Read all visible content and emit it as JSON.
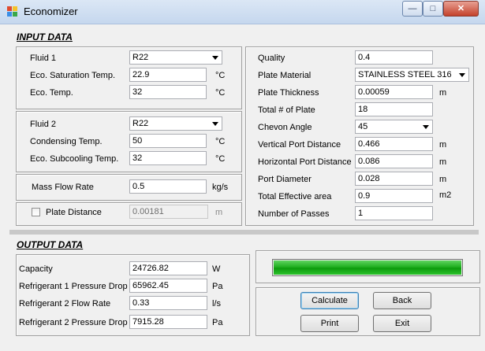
{
  "window": {
    "title": "Economizer",
    "min_glyph": "—",
    "max_glyph": "□",
    "close_glyph": "✕"
  },
  "input": {
    "title": "INPUT DATA",
    "fluid1": {
      "fluid_label": "Fluid 1",
      "fluid_value": "R22",
      "sat_label": "Eco. Saturation Temp.",
      "sat_value": "22.9",
      "sat_unit": "°C",
      "temp_label": "Eco. Temp.",
      "temp_value": "32",
      "temp_unit": "°C"
    },
    "fluid2": {
      "fluid_label": "Fluid 2",
      "fluid_value": "R22",
      "cond_label": "Condensing Temp.",
      "cond_value": "50",
      "cond_unit": "°C",
      "subcool_label": "Eco. Subcooling Temp.",
      "subcool_value": "32",
      "subcool_unit": "°C"
    },
    "mass_flow": {
      "label": "Mass Flow Rate",
      "value": "0.5",
      "unit": "kg/s"
    },
    "plate_distance": {
      "label": "Plate Distance",
      "value": "0.00181",
      "unit": "m",
      "checked": false
    },
    "right": {
      "quality_label": "Quality",
      "quality_value": "0.4",
      "material_label": "Plate Material",
      "material_value": "STAINLESS STEEL 316",
      "thickness_label": "Plate Thickness",
      "thickness_value": "0.00059",
      "thickness_unit": "m",
      "num_plate_label": "Total # of Plate",
      "num_plate_value": "18",
      "chevron_label": "Chevon Angle",
      "chevron_value": "45",
      "vport_label": "Vertical Port Distance",
      "vport_value": "0.466",
      "vport_unit": "m",
      "hport_label": "Horizontal Port Distance",
      "hport_value": "0.086",
      "hport_unit": "m",
      "port_diam_label": "Port Diameter",
      "port_diam_value": "0.028",
      "port_diam_unit": "m",
      "area_label": "Total Effective area",
      "area_value": "0.9",
      "area_unit": "m2",
      "passes_label": "Number of Passes",
      "passes_value": "1"
    }
  },
  "output": {
    "title": "OUTPUT DATA",
    "capacity_label": "Capacity",
    "capacity_value": "24726.82",
    "capacity_unit": "W",
    "r1_pd_label": "Refrigerant 1 Pressure Drop",
    "r1_pd_value": "65962.45",
    "r1_pd_unit": "Pa",
    "r2_flow_label": "Refrigerant 2 Flow Rate",
    "r2_flow_value": "0.33",
    "r2_flow_unit": "l/s",
    "r2_pd_label": "Refrigerant 2 Pressure Drop",
    "r2_pd_value": "7915.28",
    "r2_pd_unit": "Pa"
  },
  "progress": {
    "value": 1.0
  },
  "buttons": {
    "calculate": "Calculate",
    "back": "Back",
    "print": "Print",
    "exit": "Exit"
  },
  "colors": {
    "progress_fill": "#22b022",
    "titlebar": "#c5d7ee",
    "close_button": "#c4422c"
  }
}
